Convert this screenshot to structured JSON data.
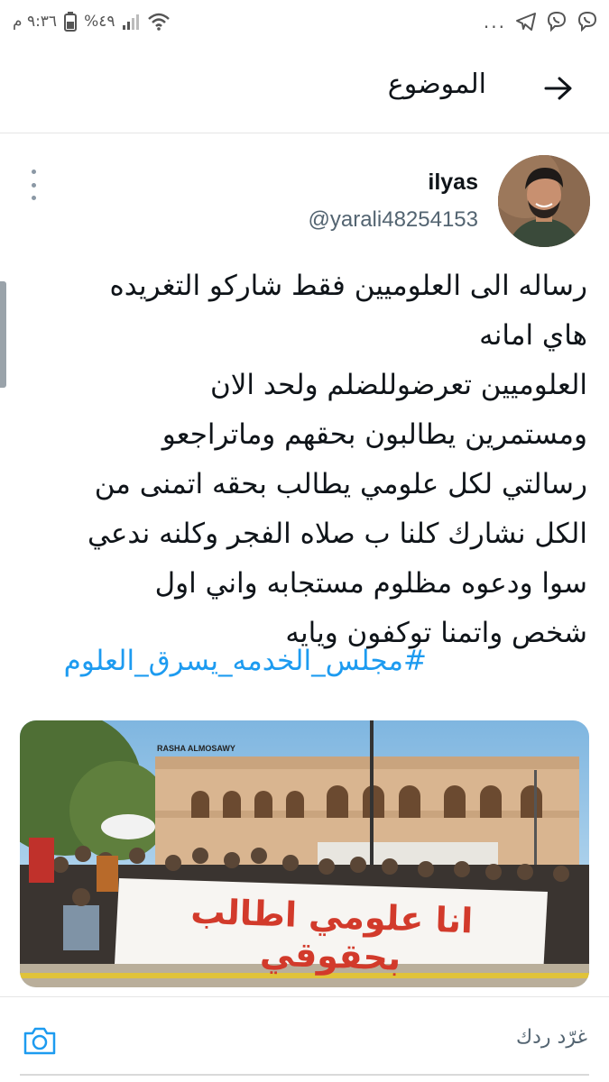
{
  "status_bar": {
    "time": "٩:٣٦ م",
    "battery": "%٤٩",
    "overflow": "..."
  },
  "header": {
    "title": "الموضوع"
  },
  "tweet": {
    "display_name": "ilyas",
    "handle": "@yarali48254153",
    "text_lines": [
      "رساله الى العلوميين فقط شاركو التغريده",
      "هاي امانه",
      "العلوميين تعرضوللضلم ولحد الان",
      "ومستمرين يطالبون بحقهم وماتراجعو",
      "رسالتي لكل علومي يطالب بحقه اتمنى من",
      "الكل نشارك كلنا ب صلاه الفجر وكلنه ندعي",
      "سوا ودعوه مظلوم مستجابه واني اول",
      "شخص واتمنا توكفون ويايه"
    ],
    "hashtag": "#مجلس_الخدمه_يسرق_العلوم",
    "media": {
      "watermark": "RASHA ALMOSAWY",
      "banner_text": "انا علومي اطالب بحقوقي"
    }
  },
  "reply": {
    "placeholder": "غرّد ردك"
  },
  "colors": {
    "link": "#1d9bf0",
    "secondary_text": "#536471",
    "primary_text": "#0f1419",
    "banner_text": "#d23a2b"
  },
  "icons": [
    "back-arrow-icon",
    "more-vertical-icon",
    "camera-icon",
    "wifi-icon",
    "signal-icon",
    "battery-icon",
    "telegram-icon",
    "viber-icon"
  ]
}
